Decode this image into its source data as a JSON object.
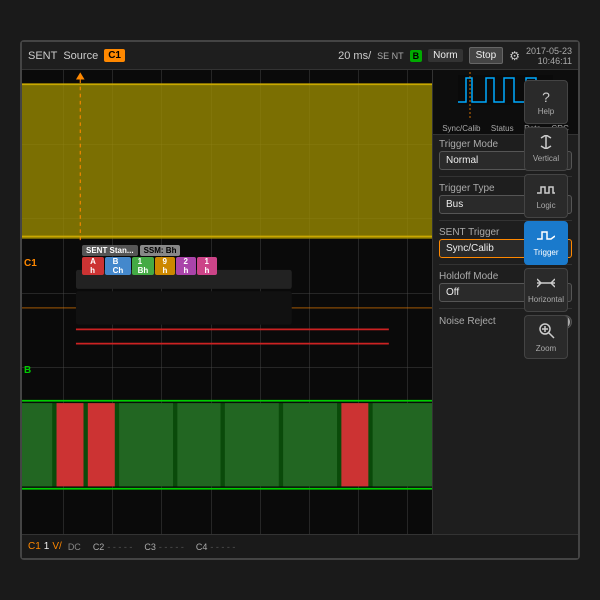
{
  "topbar": {
    "protocol": "SENT",
    "source_label": "Source",
    "channel": "C1",
    "timebase": "20 ms/",
    "se_nt": "SE NT",
    "ch_b_label": "B",
    "norm_label": "Norm",
    "stop_label": "Stop",
    "timestamp": "2017-05-23",
    "time": "10:46:11"
  },
  "mini_preview": {
    "labels": [
      "Sync/Calib",
      "Status",
      "Data",
      "CRC"
    ]
  },
  "side_nav": {
    "items": [
      {
        "label": "Help",
        "icon": "?",
        "active": false
      },
      {
        "label": "Vertical",
        "icon": "↕",
        "active": false
      },
      {
        "label": "Logic",
        "icon": "⊓⊓",
        "active": false
      },
      {
        "label": "Trigger",
        "icon": "∿",
        "active": true
      },
      {
        "label": "Horizontal",
        "icon": "↔",
        "active": false
      },
      {
        "label": "Zoom",
        "icon": "⊕",
        "active": false
      }
    ]
  },
  "right_panel": {
    "trigger_mode_label": "Trigger Mode",
    "trigger_mode_value": "Normal",
    "trigger_type_label": "Trigger Type",
    "trigger_type_value": "Bus",
    "sent_trigger_label": "SENT Trigger",
    "sent_trigger_value": "Sync/Calib",
    "holdoff_mode_label": "Holdoff Mode",
    "holdoff_mode_value": "Off",
    "noise_reject_label": "Noise Reject"
  },
  "decode_overlay": {
    "header1": "SENT Stan...",
    "header2": "SSM: Bh",
    "cells": [
      {
        "label": "A h",
        "color": "#cc3333"
      },
      {
        "label": "B C h",
        "color": "#4488cc"
      },
      {
        "label": "1 B h",
        "color": "#44aa44"
      },
      {
        "label": "9 h",
        "color": "#cc8800"
      },
      {
        "label": "2 h",
        "color": "#aa44aa"
      },
      {
        "label": "1 h",
        "color": "#cc4488"
      }
    ]
  },
  "bottom_bar": {
    "ch1_label": "C1",
    "ch1_volt": "1",
    "ch1_unit": "V/",
    "ch1_coupling": "DC",
    "ch2_label": "C2",
    "ch3_label": "C3",
    "ch4_label": "C4"
  },
  "colors": {
    "ch1": "#ccaa00",
    "ch_b": "#00cc00",
    "accent_orange": "#ff8800",
    "trigger_blue": "#1a7acc"
  }
}
